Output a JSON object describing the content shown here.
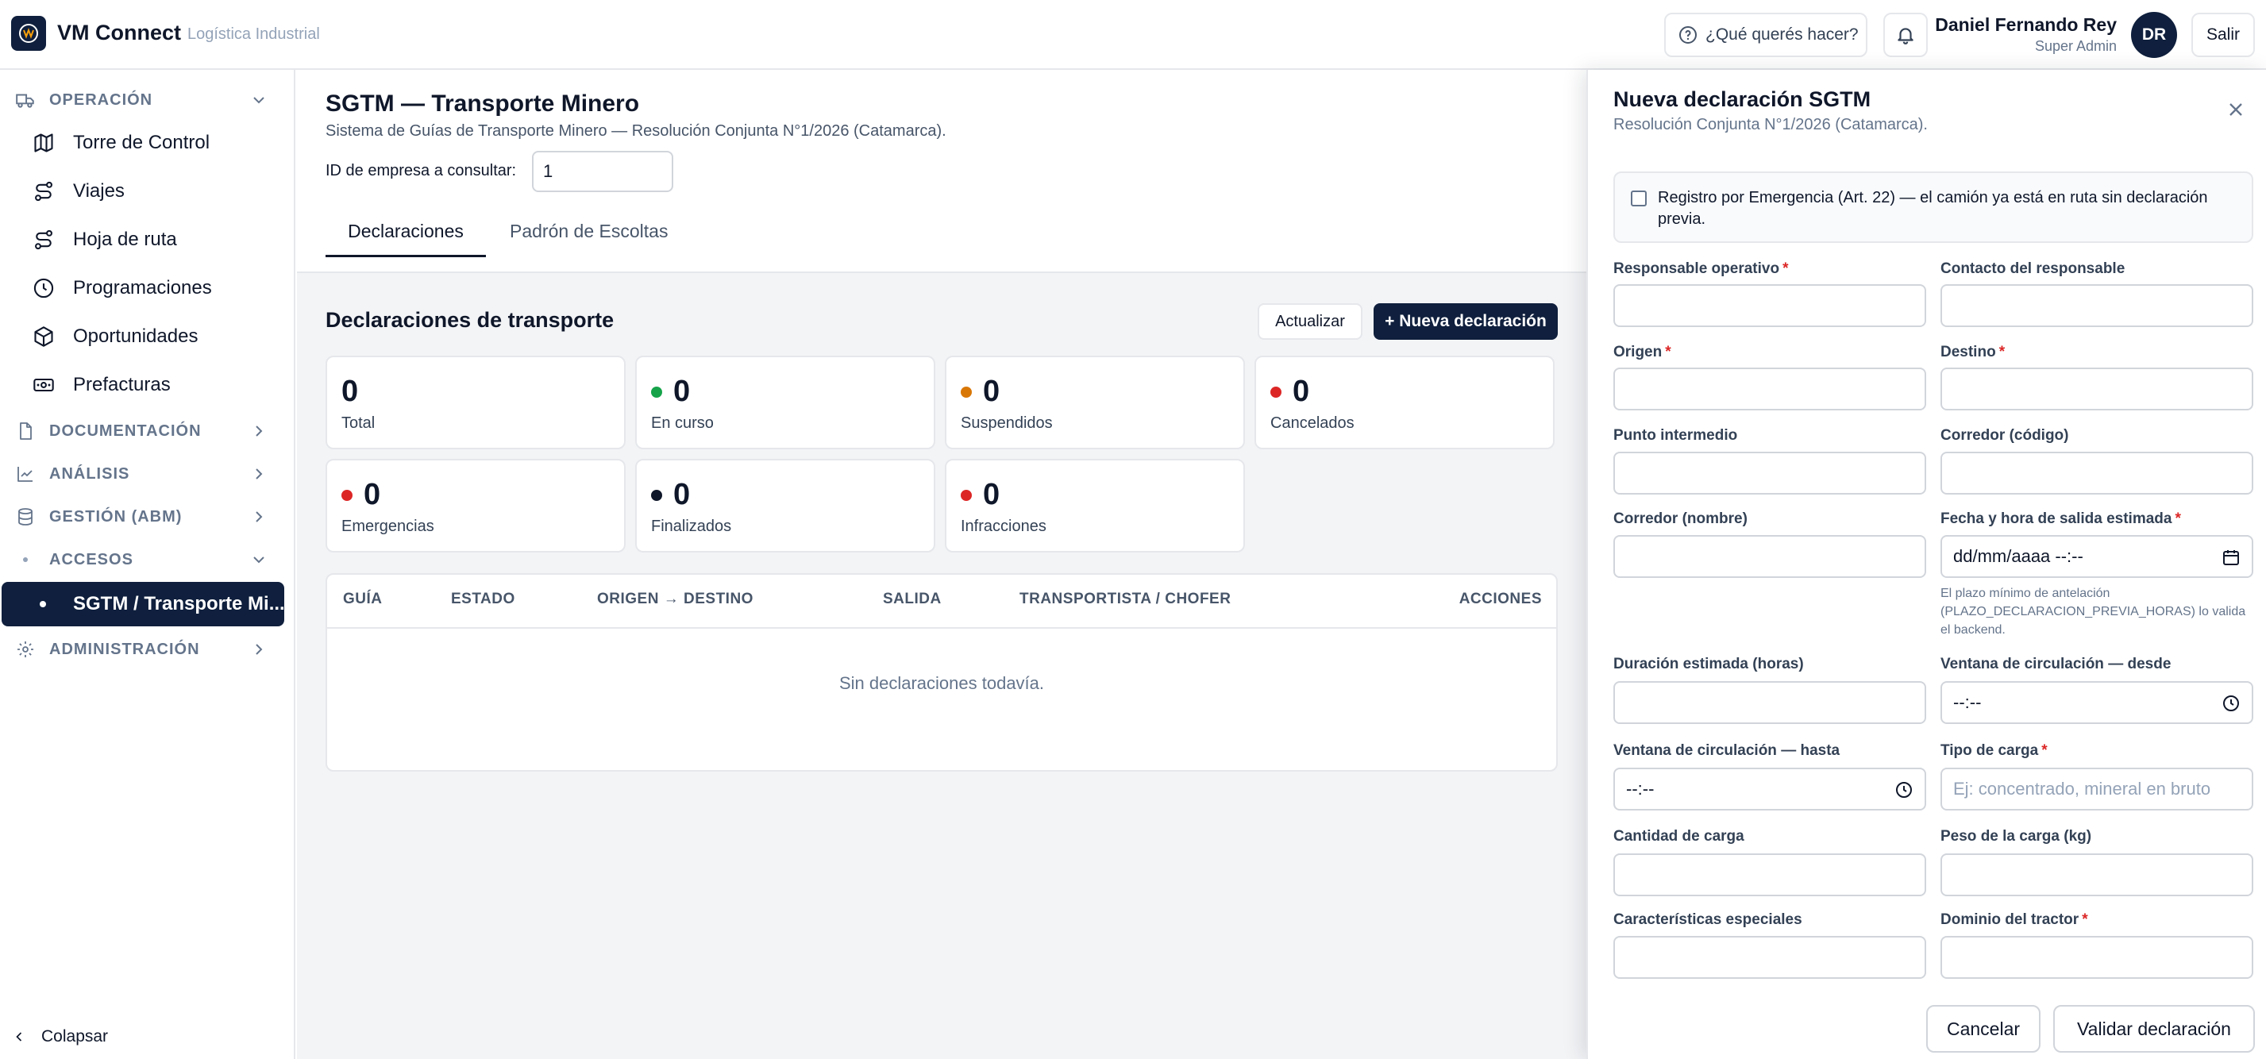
{
  "app": {
    "brand": "VM Connect",
    "brand_sub": "Logística Industrial",
    "help_label": "¿Qué querés hacer?",
    "user_name": "Daniel Fernando Rey",
    "user_role": "Super Admin",
    "avatar_initials": "DR",
    "logout_label": "Salir"
  },
  "sidebar": {
    "operacion": "OPERACIÓN",
    "items": [
      {
        "label": "Torre de Control",
        "icon": "map-icon"
      },
      {
        "label": "Viajes",
        "icon": "route-icon"
      },
      {
        "label": "Hoja de ruta",
        "icon": "route-icon"
      },
      {
        "label": "Programaciones",
        "icon": "clock-icon"
      },
      {
        "label": "Oportunidades",
        "icon": "box-icon"
      },
      {
        "label": "Prefacturas",
        "icon": "bill-icon"
      }
    ],
    "documentacion": "DOCUMENTACIÓN",
    "analisis": "ANÁLISIS",
    "gestion": "GESTIÓN (ABM)",
    "accesos": "ACCESOS",
    "active_item": "SGTM / Transporte Mi...",
    "administracion": "ADMINISTRACIÓN",
    "collapse": "Colapsar"
  },
  "main": {
    "title": "SGTM — Transporte Minero",
    "subtitle": "Sistema de Guías de Transporte Minero — Resolución Conjunta N°1/2026 (Catamarca).",
    "company_label": "ID de empresa a consultar:",
    "company_value": "1",
    "tabs": [
      "Declaraciones",
      "Padrón de Escoltas"
    ],
    "section_title": "Declaraciones de transporte",
    "refresh_label": "Actualizar",
    "new_label": "+ Nueva declaración",
    "stats": [
      {
        "value": "0",
        "label": "Total",
        "color": ""
      },
      {
        "value": "0",
        "label": "En curso",
        "color": "#16a34a"
      },
      {
        "value": "0",
        "label": "Suspendidos",
        "color": "#d97706"
      },
      {
        "value": "0",
        "label": "Cancelados",
        "color": "#dc2626"
      },
      {
        "value": "0",
        "label": "Emergencias",
        "color": "#dc2626"
      },
      {
        "value": "0",
        "label": "Finalizados",
        "color": "#0f172a"
      },
      {
        "value": "0",
        "label": "Infracciones",
        "color": "#dc2626"
      }
    ],
    "table_headers": [
      "GUÍA",
      "ESTADO",
      "ORIGEN → DESTINO",
      "SALIDA",
      "TRANSPORTISTA / CHOFER",
      "ACCIONES"
    ],
    "empty": "Sin declaraciones todavía."
  },
  "panel": {
    "title": "Nueva declaración SGTM",
    "subtitle": "Resolución Conjunta N°1/2026 (Catamarca).",
    "emergency": "Registro por Emergencia (Art. 22) — el camión ya está en ruta sin declaración previa.",
    "fields": {
      "responsable": "Responsable operativo",
      "contacto": "Contacto del responsable",
      "origen": "Origen",
      "destino": "Destino",
      "punto": "Punto intermedio",
      "corredor_cod": "Corredor (código)",
      "corredor_nom": "Corredor (nombre)",
      "fecha_salida": "Fecha y hora de salida estimada",
      "fecha_value": "dd/mm/aaaa --:--",
      "fecha_help": "El plazo mínimo de antelación (PLAZO_DECLARACION_PREVIA_HORAS) lo valida el backend.",
      "duracion": "Duración estimada (horas)",
      "ventana_desde": "Ventana de circulación — desde",
      "ventana_desde_value": "--:--",
      "ventana_hasta": "Ventana de circulación — hasta",
      "ventana_hasta_value": "--:--",
      "tipo_carga": "Tipo de carga",
      "tipo_carga_ph": "Ej: concentrado, mineral en bruto",
      "cantidad": "Cantidad de carga",
      "peso": "Peso de la carga (kg)",
      "caracteristicas": "Características especiales",
      "dominio": "Dominio del tractor",
      "required_mark": "*"
    },
    "cancel_label": "Cancelar",
    "validate_label": "Validar declaración"
  }
}
